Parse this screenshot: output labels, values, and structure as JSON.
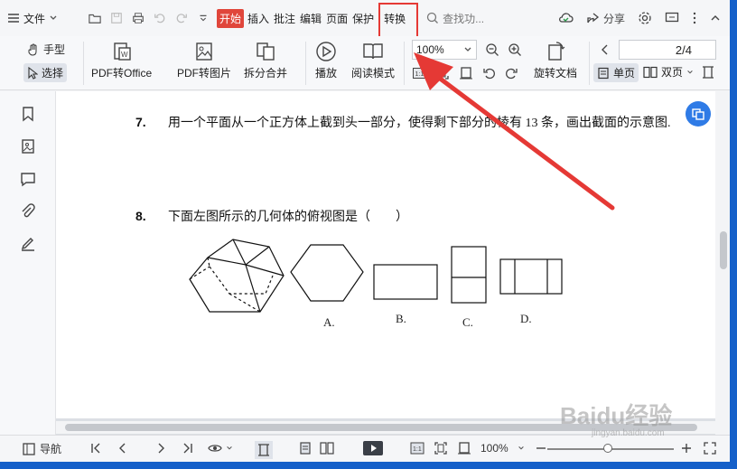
{
  "menubar": {
    "file_label": "文件",
    "tabs": [
      {
        "label": "开始",
        "active": true
      },
      {
        "label": "插入",
        "active": false
      },
      {
        "label": "批注",
        "active": false
      },
      {
        "label": "编辑",
        "active": false
      },
      {
        "label": "页面",
        "active": false
      },
      {
        "label": "保护",
        "active": false
      },
      {
        "label": "转换",
        "active": false
      }
    ],
    "search_placeholder": "查找功...",
    "share_label": "分享"
  },
  "toolbar": {
    "hand_label": "手型",
    "select_label": "选择",
    "pdf_to_office": "PDF转Office",
    "pdf_to_image": "PDF转图片",
    "split_merge": "拆分合并",
    "play": "播放",
    "read_mode": "阅读模式",
    "zoom_value": "100%",
    "rotate_doc": "旋转文档",
    "page_indicator": "2/4",
    "single_page": "单页",
    "double_page": "双页"
  },
  "document": {
    "q7_num": "7.",
    "q7_text": "用一个平面从一个正方体上截到头一部分，使得剩下部分的棱有 13 条，画出截面的示意图.",
    "q8_num": "8.",
    "q8_text": "下面左图所示的几何体的俯视图是（　　）",
    "options": [
      "A.",
      "B.",
      "C.",
      "D."
    ]
  },
  "statusbar": {
    "nav_label": "导航",
    "zoom_value": "100%"
  },
  "watermark": {
    "brand": "Baidu经验",
    "sub": "jingyan.baidu.com"
  },
  "colors": {
    "active_tab": "#e0463b",
    "highlight_box": "#e53935",
    "arrow": "#e53935",
    "float_button": "#2f7be6"
  }
}
